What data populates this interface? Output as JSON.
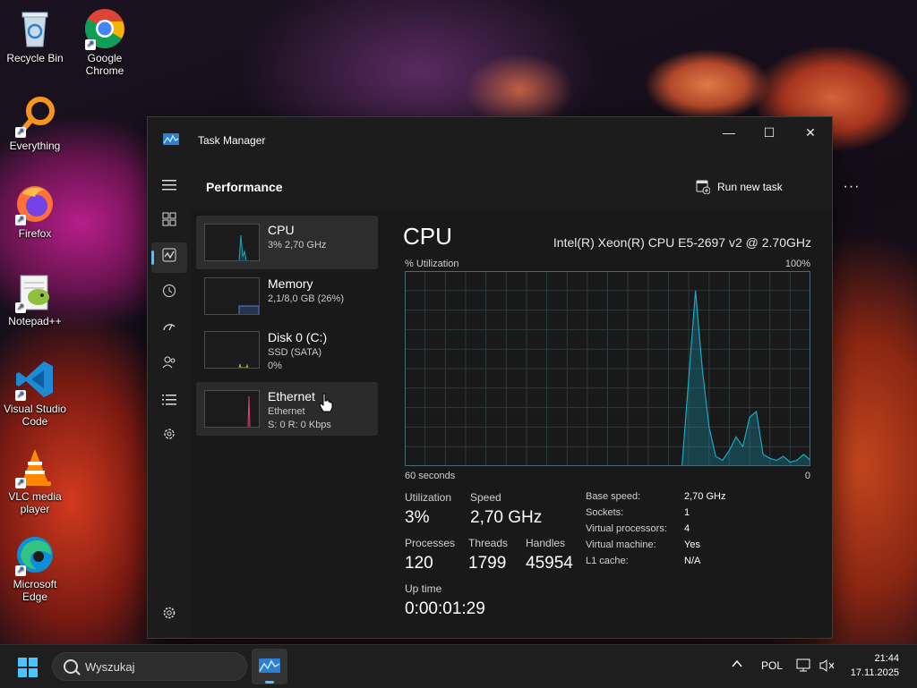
{
  "desktop": {
    "icons": [
      {
        "label": "Recycle Bin"
      },
      {
        "label": "Google Chrome"
      },
      {
        "label": "Everything"
      },
      {
        "label": "Firefox"
      },
      {
        "label": "Notepad++"
      },
      {
        "label": "Visual Studio Code"
      },
      {
        "label": "VLC media player"
      },
      {
        "label": "Microsoft Edge"
      }
    ]
  },
  "window": {
    "title": "Task Manager",
    "controls": {
      "minimize": "—",
      "maximize": "☐",
      "close": "✕"
    }
  },
  "header": {
    "page_title": "Performance",
    "run_new_task": "Run new task",
    "more": "···"
  },
  "nav": {
    "items": [
      {
        "icon": "hamburger-icon"
      },
      {
        "icon": "processes-icon"
      },
      {
        "icon": "performance-icon",
        "active": true
      },
      {
        "icon": "app-history-icon"
      },
      {
        "icon": "startup-apps-icon"
      },
      {
        "icon": "users-icon"
      },
      {
        "icon": "details-icon"
      },
      {
        "icon": "services-icon"
      },
      {
        "icon": "settings-icon"
      }
    ]
  },
  "resources": [
    {
      "name": "CPU",
      "line1": "3% 2,70 GHz",
      "line2": "",
      "color": "#17a9c6",
      "selected": true
    },
    {
      "name": "Memory",
      "line1": "2,1/8,0 GB (26%)",
      "line2": "",
      "color": "#4c7fd9"
    },
    {
      "name": "Disk 0 (C:)",
      "line1": "SSD (SATA)",
      "line2": "0%",
      "color": "#8fbf3a"
    },
    {
      "name": "Ethernet",
      "line1": "Ethernet",
      "line2": "S: 0 R: 0 Kbps",
      "color": "#e0417a"
    }
  ],
  "cpu": {
    "title": "CPU",
    "model": "Intel(R) Xeon(R) CPU E5-2697 v2 @ 2.70GHz",
    "graph_label": "% Utilization",
    "graph_max": "100%",
    "time_label": "60 seconds",
    "graph_min": "0",
    "stats": {
      "utilization_label": "Utilization",
      "utilization": "3%",
      "speed_label": "Speed",
      "speed": "2,70 GHz",
      "processes_label": "Processes",
      "processes": "120",
      "threads_label": "Threads",
      "threads": "1799",
      "handles_label": "Handles",
      "handles": "45954",
      "uptime_label": "Up time",
      "uptime": "0:00:01:29"
    },
    "specs": [
      {
        "key": "Base speed:",
        "value": "2,70 GHz"
      },
      {
        "key": "Sockets:",
        "value": "1"
      },
      {
        "key": "Virtual processors:",
        "value": "4"
      },
      {
        "key": "Virtual machine:",
        "value": "Yes"
      },
      {
        "key": "L1 cache:",
        "value": "N/A"
      }
    ]
  },
  "chart_data": {
    "type": "area",
    "x": [
      0,
      1,
      2,
      3,
      4,
      5,
      6,
      7,
      8,
      9,
      10,
      11,
      12,
      13,
      14,
      15,
      16,
      17,
      18,
      19,
      20,
      21,
      22,
      23,
      24,
      25,
      26,
      27,
      28,
      29,
      30,
      31,
      32,
      33,
      34,
      35,
      36,
      37,
      38,
      39,
      40,
      41,
      42,
      43,
      44,
      45,
      46,
      47,
      48,
      49,
      50,
      51,
      52,
      53,
      54,
      55,
      56,
      57,
      58,
      59,
      60
    ],
    "series": [
      {
        "values": [
          null,
          null,
          null,
          null,
          null,
          null,
          null,
          null,
          null,
          null,
          null,
          null,
          null,
          null,
          null,
          null,
          null,
          null,
          null,
          null,
          null,
          null,
          null,
          null,
          null,
          null,
          null,
          null,
          null,
          null,
          null,
          null,
          null,
          null,
          null,
          null,
          null,
          null,
          null,
          null,
          null,
          0,
          45,
          90,
          50,
          20,
          5,
          3,
          8,
          15,
          10,
          25,
          28,
          6,
          4,
          3,
          5,
          2,
          3,
          6,
          3
        ]
      }
    ],
    "ylim": [
      0,
      100
    ],
    "grid": true,
    "color": "#17a9c6"
  },
  "taskbar": {
    "search_placeholder": "Wyszukaj",
    "language": "POL",
    "time": "21:44",
    "date": "17.11.2025"
  }
}
